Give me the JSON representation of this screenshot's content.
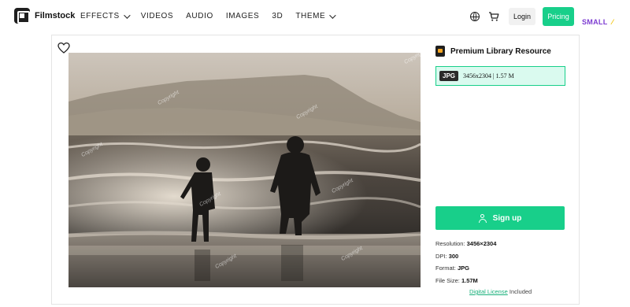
{
  "header": {
    "brand": "Filmstock",
    "nav": [
      {
        "label": "EFFECTS",
        "has_dropdown": true
      },
      {
        "label": "VIDEOS",
        "has_dropdown": false
      },
      {
        "label": "AUDIO",
        "has_dropdown": false
      },
      {
        "label": "IMAGES",
        "has_dropdown": false
      },
      {
        "label": "3D",
        "has_dropdown": false
      },
      {
        "label": "THEME",
        "has_dropdown": true
      }
    ],
    "login_label": "Login",
    "pricing_label": "Pricing",
    "badge_text": "SMALL",
    "icons": [
      "globe-icon",
      "cart-icon"
    ]
  },
  "asset": {
    "watermark": "Copyright",
    "resource_label": "Premium Library Resource",
    "format_tag": "JPG",
    "format_info": "3456x2304 | 1.57 M",
    "signup_label": "Sign up",
    "resolution_label": "Resolution:",
    "resolution_value": "3456×2304",
    "dpi_label": "DPI:",
    "dpi_value": "300",
    "format_label": "Format:",
    "format_value": "JPG",
    "filesize_label": "File Size:",
    "filesize_value": "1.57M",
    "license_link": "Digital License",
    "license_suffix": " Included"
  },
  "colors": {
    "accent": "#18cf8a",
    "badge": "#7c3bd1"
  }
}
